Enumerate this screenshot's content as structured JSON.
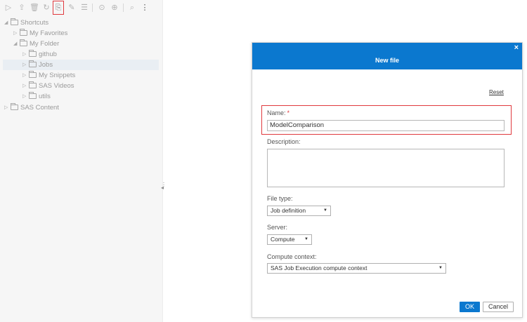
{
  "toolbar": {
    "icons": [
      "run-icon",
      "upload-icon",
      "delete-icon",
      "refresh-icon",
      "new-file-icon",
      "edit-icon",
      "list-icon",
      "properties-icon",
      "add-icon",
      "search-icon",
      "more-icon"
    ]
  },
  "tree": {
    "items": [
      {
        "label": "Shortcuts",
        "level": 0,
        "expanded": true
      },
      {
        "label": "My Favorites",
        "level": 1,
        "expanded": false
      },
      {
        "label": "My Folder",
        "level": 1,
        "expanded": true
      },
      {
        "label": "github",
        "level": 2,
        "expanded": false
      },
      {
        "label": "Jobs",
        "level": 2,
        "expanded": false,
        "selected": true
      },
      {
        "label": "My Snippets",
        "level": 2,
        "expanded": false
      },
      {
        "label": "SAS Videos",
        "level": 2,
        "expanded": false
      },
      {
        "label": "utils",
        "level": 2,
        "expanded": false
      },
      {
        "label": "SAS Content",
        "level": 0,
        "expanded": false
      }
    ]
  },
  "dialog": {
    "title": "New file",
    "close": "×",
    "reset_label": "Reset",
    "name_label": "Name:",
    "name_required_mark": "*",
    "name_value": "ModelComparison",
    "description_label": "Description:",
    "description_value": "",
    "file_type_label": "File type:",
    "file_type_value": "Job definition",
    "server_label": "Server:",
    "server_value": "Compute",
    "compute_context_label": "Compute context:",
    "compute_context_value": "SAS Job Execution compute context",
    "ok_label": "OK",
    "cancel_label": "Cancel"
  },
  "colors": {
    "accent": "#0b78cf",
    "highlight": "#e0393e"
  }
}
